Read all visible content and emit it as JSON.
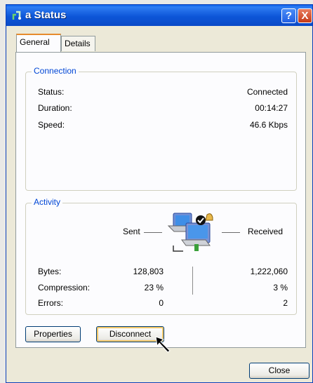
{
  "window": {
    "title": "a Status",
    "help_label": "?",
    "close_label": "X"
  },
  "tabs": [
    {
      "label": "General",
      "active": true
    },
    {
      "label": "Details",
      "active": false
    }
  ],
  "connection": {
    "legend": "Connection",
    "rows": [
      {
        "label": "Status:",
        "value": "Connected"
      },
      {
        "label": "Duration:",
        "value": "00:14:27"
      },
      {
        "label": "Speed:",
        "value": "46.6 Kbps"
      }
    ]
  },
  "activity": {
    "legend": "Activity",
    "sent_label": "Sent",
    "received_label": "Received",
    "rows": [
      {
        "label": "Bytes:",
        "sent": "128,803",
        "received": "1,222,060"
      },
      {
        "label": "Compression:",
        "sent": "23 %",
        "received": "3 %"
      },
      {
        "label": "Errors:",
        "sent": "0",
        "received": "2"
      }
    ],
    "icon": "network-computers-icon"
  },
  "buttons": {
    "properties": "Properties",
    "disconnect": "Disconnect",
    "close": "Close"
  },
  "colors": {
    "titlebar": "#0a56d8",
    "legend": "#0046d5",
    "tab_accent": "#e68b2c",
    "background": "#ece9d8"
  }
}
